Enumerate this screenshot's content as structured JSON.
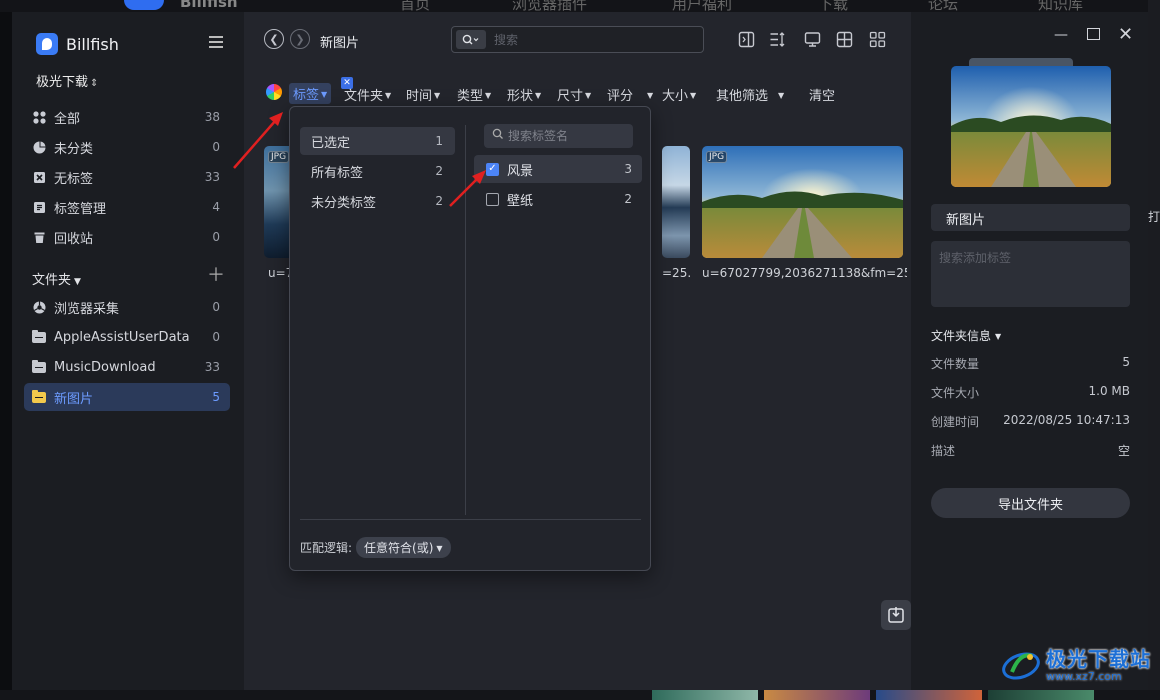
{
  "background": {
    "brand": "Billfish",
    "nav": [
      "首页",
      "浏览器插件",
      "用户福利",
      "下载",
      "论坛",
      "知识库"
    ]
  },
  "sidebar": {
    "app_name": "Billfish",
    "library": "极光下载",
    "items": [
      {
        "label": "全部",
        "count": "38",
        "icon": "grid-icon"
      },
      {
        "label": "未分类",
        "count": "0",
        "icon": "pie-icon"
      },
      {
        "label": "无标签",
        "count": "33",
        "icon": "tag-off-icon"
      },
      {
        "label": "标签管理",
        "count": "4",
        "icon": "tag-manage-icon"
      },
      {
        "label": "回收站",
        "count": "0",
        "icon": "trash-icon"
      }
    ],
    "folders_title": "文件夹",
    "folders": [
      {
        "label": "浏览器采集",
        "count": "0",
        "icon": "browser-collect-icon"
      },
      {
        "label": "AppleAssistUserData",
        "count": "0",
        "icon": "folder-icon"
      },
      {
        "label": "MusicDownload",
        "count": "33",
        "icon": "folder-icon"
      },
      {
        "label": "新图片",
        "count": "5",
        "icon": "folder-icon",
        "active": true
      }
    ]
  },
  "header": {
    "breadcrumb": "新图片",
    "search_placeholder": "搜索"
  },
  "filters": {
    "active": "标签",
    "items": [
      "文件夹",
      "时间",
      "类型",
      "形状",
      "尺寸",
      "评分",
      "大小",
      "其他筛选"
    ],
    "clear": "清空"
  },
  "grid": {
    "items": [
      {
        "badge": "JPG",
        "caption": "u=7"
      },
      {
        "badge": "",
        "caption": "=25..."
      },
      {
        "badge": "JPG",
        "caption": "u=67027799,2036271138&fm=25..."
      }
    ]
  },
  "tag_dropdown": {
    "left_items": [
      {
        "label": "已选定",
        "count": "1",
        "selected": true
      },
      {
        "label": "所有标签",
        "count": "2"
      },
      {
        "label": "未分类标签",
        "count": "2"
      }
    ],
    "search_placeholder": "搜索标签名",
    "tags": [
      {
        "label": "风景",
        "count": "3",
        "checked": true
      },
      {
        "label": "壁纸",
        "count": "2",
        "checked": false
      }
    ],
    "match_label": "匹配逻辑:",
    "match_value": "任意符合(或)"
  },
  "panel": {
    "name": "新图片",
    "tag_placeholder": "搜索添加标签",
    "info_title": "文件夹信息",
    "info": [
      {
        "label": "文件数量",
        "value": "5"
      },
      {
        "label": "文件大小",
        "value": "1.0 MB"
      },
      {
        "label": "创建时间",
        "value": "2022/08/25 10:47:13"
      },
      {
        "label": "描述",
        "value": "空"
      }
    ],
    "export": "导出文件夹"
  },
  "watermark": {
    "cn": "极光下载站",
    "url": "www.xz7.com"
  },
  "colors": {
    "accent": "#6c9bff",
    "checkbox": "#4c84f6",
    "sidebar_bg": "#1b1d22",
    "main_bg": "#23252c"
  }
}
